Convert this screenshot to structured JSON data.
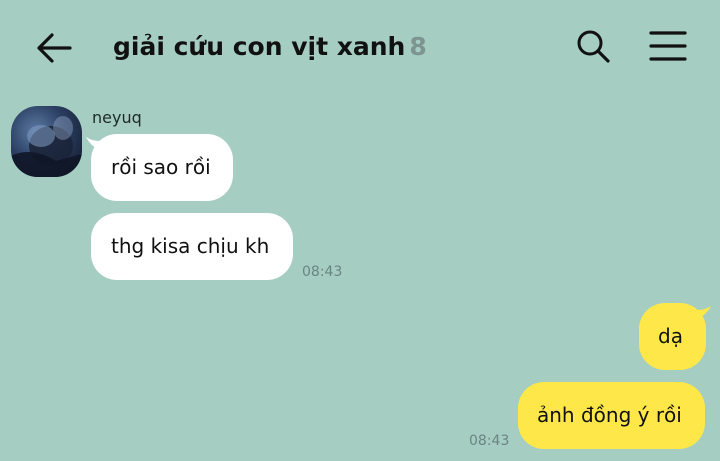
{
  "header": {
    "title": "giải cứu con vịt xanh",
    "member_count": "8",
    "back_icon": "arrow-left-icon",
    "search_icon": "search-icon",
    "menu_icon": "hamburger-menu-icon"
  },
  "colors": {
    "background": "#a6cdc1",
    "incoming_bubble": "#ffffff",
    "outgoing_bubble": "#fee849",
    "timestamp": "#6a8580"
  },
  "messages": {
    "incoming": {
      "sender": "neyuq",
      "items": [
        {
          "text": "rồi sao rồi"
        },
        {
          "text": "thg kisa chịu kh"
        }
      ],
      "time": "08:43"
    },
    "outgoing": {
      "items": [
        {
          "text": "dạ"
        },
        {
          "text": "ảnh đồng ý rồi"
        }
      ],
      "time": "08:43"
    }
  }
}
